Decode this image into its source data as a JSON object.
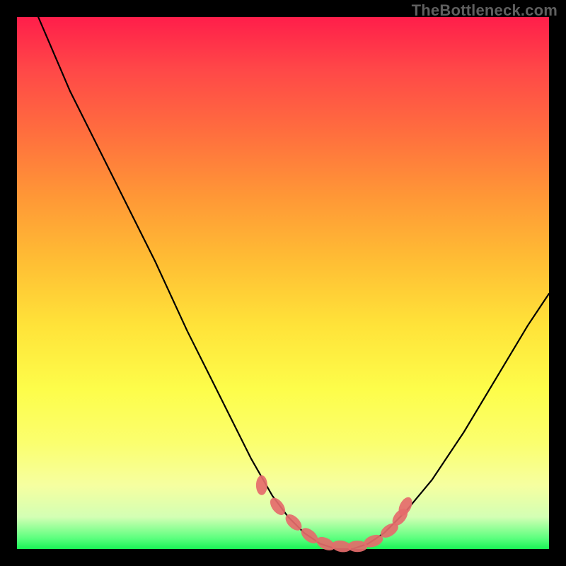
{
  "watermark": "TheBottleneck.com",
  "colors": {
    "background": "#000000",
    "curve": "#000000",
    "marker_fill": "#e56b6b",
    "marker_stroke": "#d65a5a"
  },
  "chart_data": {
    "type": "line",
    "title": "",
    "xlabel": "",
    "ylabel": "",
    "xlim": [
      0,
      100
    ],
    "ylim": [
      0,
      100
    ],
    "series": [
      {
        "name": "bottleneck-curve",
        "x": [
          4,
          10,
          18,
          26,
          32,
          36,
          40,
          44,
          48,
          51,
          54,
          57,
          60,
          63,
          66,
          69,
          73,
          78,
          84,
          90,
          96,
          100
        ],
        "y": [
          100,
          86,
          70,
          54,
          41,
          33,
          25,
          17,
          10,
          6,
          3,
          1,
          0,
          0,
          1,
          3,
          7,
          13,
          22,
          32,
          42,
          48
        ]
      }
    ],
    "markers": {
      "name": "highlighted-points",
      "x": [
        46,
        49,
        52,
        55,
        58,
        61,
        64,
        67,
        70,
        72,
        73
      ],
      "y": [
        12,
        8,
        5,
        2.5,
        1,
        0.5,
        0.5,
        1.5,
        3.5,
        6,
        8
      ]
    }
  }
}
